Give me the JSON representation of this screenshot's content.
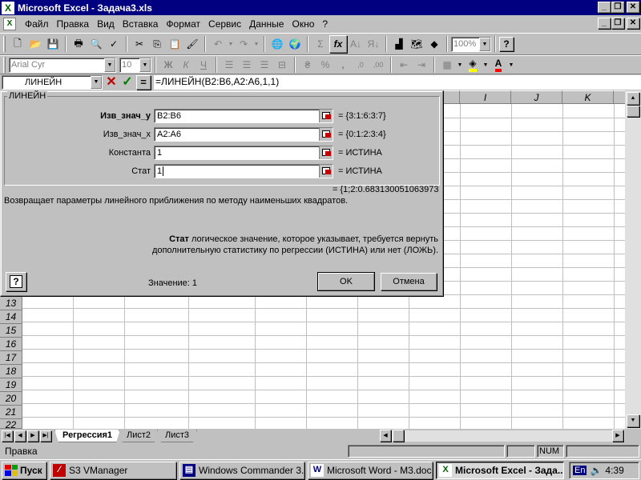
{
  "window": {
    "title": "Microsoft Excel - Задача3.xls",
    "app_icon": "excel-icon"
  },
  "menu": {
    "items": [
      "Файл",
      "Правка",
      "Вид",
      "Вставка",
      "Формат",
      "Сервис",
      "Данные",
      "Окно",
      "?"
    ]
  },
  "toolbar": {
    "zoom": "100%",
    "font": "Arial Cyr",
    "font_size": "10",
    "bold": "Ж",
    "italic": "К",
    "underline": "Ч",
    "currency": "₴",
    "percent": "%",
    "comma": ",",
    "sum": "Σ",
    "fx": "fx",
    "help": "?"
  },
  "formula_bar": {
    "name_box": "ЛИНЕЙН",
    "cancel": "✕",
    "enter": "✓",
    "equals": "=",
    "formula": "=ЛИНЕЙН(B2:B6,A2:A6,1,1)"
  },
  "grid": {
    "visible_columns": [
      "I",
      "J",
      "K"
    ],
    "visible_rows": [
      "13",
      "14",
      "15",
      "16",
      "17",
      "18",
      "19",
      "20",
      "21",
      "22"
    ]
  },
  "dialog": {
    "frame_title": "ЛИНЕЙН",
    "args": [
      {
        "label": "Изв_знач_у",
        "value": "B2:B6",
        "result": "= {3:1:6:3:7}"
      },
      {
        "label": "Изв_знач_х",
        "value": "A2:A6",
        "result": "= {0:1:2:3:4}"
      },
      {
        "label": "Константа",
        "value": "1",
        "result": "= ИСТИНА"
      },
      {
        "label": "Стат",
        "value": "1",
        "result": "= ИСТИНА"
      }
    ],
    "result": "= {1;2:0.683130051063973",
    "description": "Возвращает параметры линейного приближения по методу наименьших квадратов.",
    "arg_name": "Стат",
    "arg_description_1": "логическое значение, которое указывает, требуется вернуть",
    "arg_description_2": "дополнительную статистику по регрессии (ИСТИНА) или нет (ЛОЖЬ).",
    "value_text": "Значение: 1",
    "ok_label": "OK",
    "cancel_label": "Отмена",
    "help_icon": "?"
  },
  "sheets": {
    "tabs": [
      "Регрессия1",
      "Лист2",
      "Лист3"
    ],
    "active": "Регрессия1"
  },
  "status": {
    "text": "Правка",
    "num": "NUM"
  },
  "taskbar": {
    "start": "Пуск",
    "buttons": [
      {
        "label": "S3 VManager",
        "icon": "s3-icon"
      },
      {
        "label": "Windows Commander 3.0...",
        "icon": "commander-icon"
      },
      {
        "label": "Microsoft Word - M3.doc",
        "icon": "word-icon"
      },
      {
        "label": "Microsoft Excel - Зада...",
        "icon": "excel-icon"
      }
    ],
    "lang": "En",
    "clock": "4:39"
  },
  "colors": {
    "titlebar": "#000080",
    "face": "#c0c0c0",
    "cancel_x": "#c00000",
    "enter_check": "#008000",
    "font_color": "#ff0000",
    "fill_color": "#ffff00"
  }
}
